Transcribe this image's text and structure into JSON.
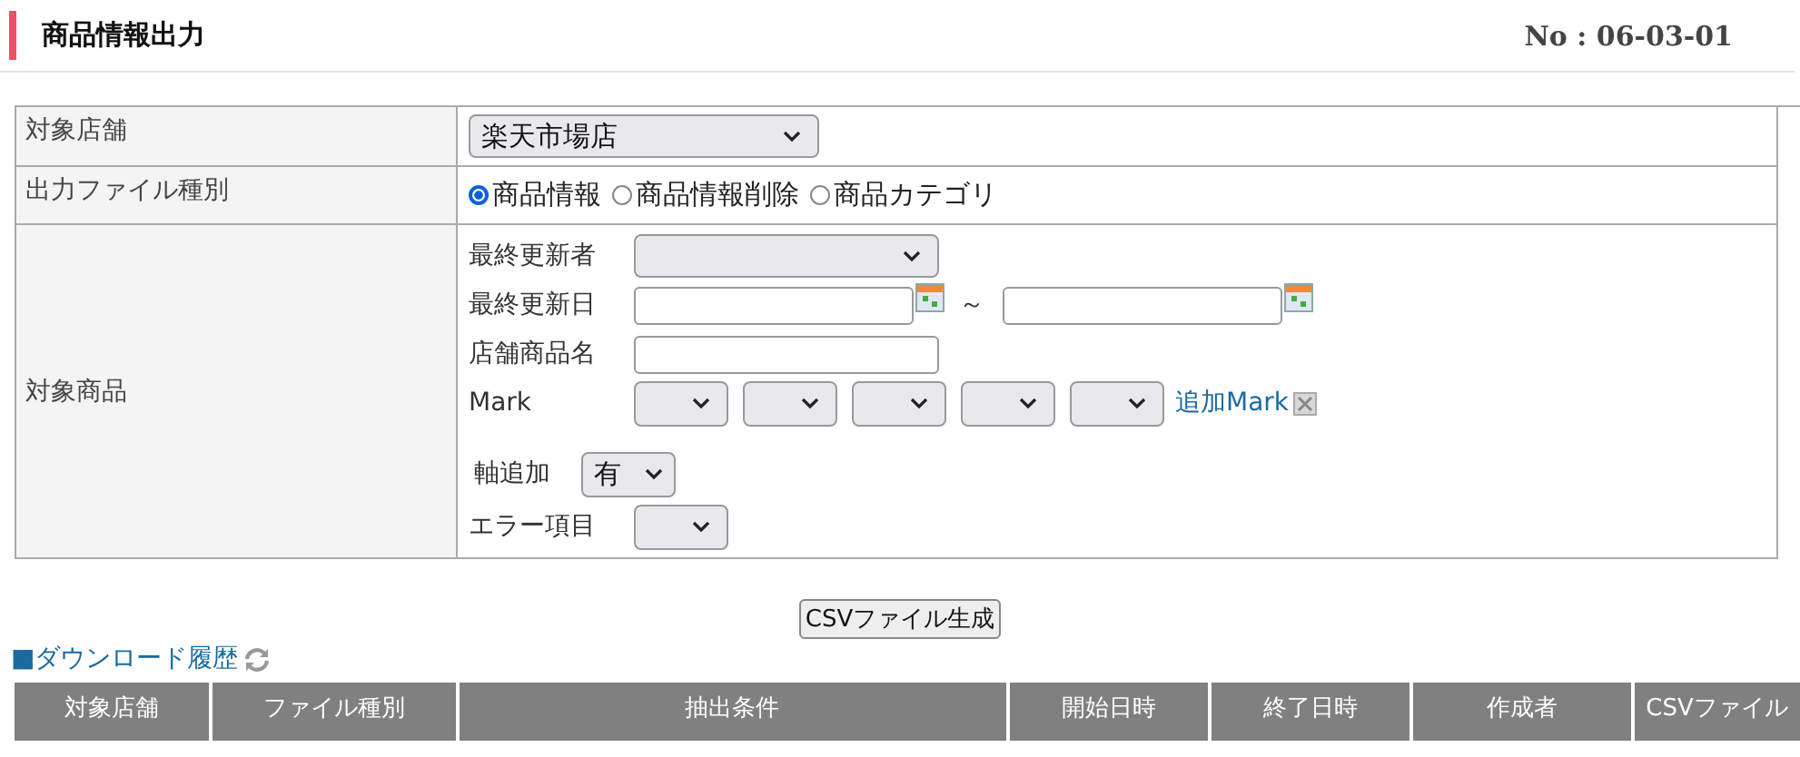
{
  "page_title": "商品情報出力",
  "page_number": "No : 06-03-01",
  "form": {
    "store": {
      "label": "対象店舗",
      "value": "楽天市場店"
    },
    "file_type": {
      "label": "出力ファイル種別",
      "options": [
        {
          "label": "商品情報",
          "selected": true
        },
        {
          "label": "商品情報削除",
          "selected": false
        },
        {
          "label": "商品カテゴリ",
          "selected": false
        }
      ]
    },
    "target": {
      "label": "対象商品",
      "fields": [
        {
          "kind": "select",
          "label": "最終更新者"
        },
        {
          "kind": "date_range",
          "label": "最終更新日",
          "separator": "～"
        },
        {
          "kind": "text",
          "label": "店舗商品名"
        },
        {
          "kind": "marks",
          "label": "Mark",
          "link": "追加Mark"
        },
        {
          "kind": "small_select",
          "label": "軸追加",
          "value": "有"
        },
        {
          "kind": "small_select",
          "label": "エラー項目"
        }
      ]
    }
  },
  "generate_button": "CSVファイル生成",
  "history": {
    "link": "■ダウンロード履歴",
    "columns": [
      "対象店舗",
      "ファイル種別",
      "抽出条件",
      "開始日時",
      "終了日時",
      "作成者",
      "CSVファイル"
    ]
  }
}
